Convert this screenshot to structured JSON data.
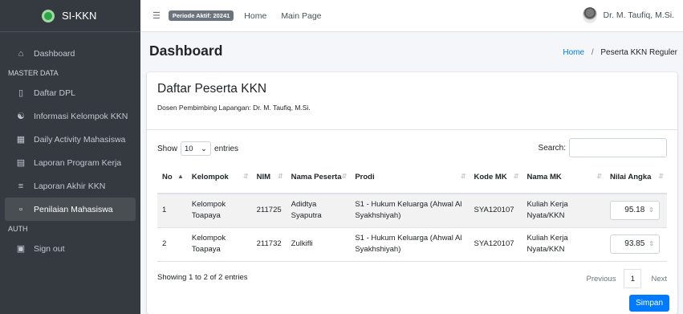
{
  "brand": {
    "name": "SI-KKN"
  },
  "sidebar": {
    "items": [
      {
        "label": "Dashboard",
        "icon": "home-icon"
      },
      {
        "label": "Daftar DPL",
        "icon": "book-icon"
      },
      {
        "label": "Informasi Kelompok KKN",
        "icon": "users-icon"
      },
      {
        "label": "Daily Activity Mahasiswa",
        "icon": "table-icon"
      },
      {
        "label": "Laporan Program Kerja",
        "icon": "file-icon"
      },
      {
        "label": "Laporan Akhir KKN",
        "icon": "list-icon"
      },
      {
        "label": "Penilaian Mahasiswa",
        "icon": "file-check-icon"
      },
      {
        "label": "Sign out",
        "icon": "signout-icon"
      }
    ],
    "headers": [
      "MASTER DATA",
      "AUTH"
    ]
  },
  "topbar": {
    "periode": "Periode Aktif: 20241",
    "links": [
      "Home",
      "Main Page"
    ],
    "user": "Dr. M. Taufiq, M.Si."
  },
  "page": {
    "title": "Dashboard",
    "breadcrumb": {
      "home": "Home",
      "separator": "/",
      "current": "Peserta KKN Reguler"
    }
  },
  "card": {
    "title": "Daftar Peserta KKN",
    "subtitle": "Dosen Pembimbing Lapangan: Dr. M. Taufiq, M.Si."
  },
  "datatable": {
    "show_label": "Show",
    "entries_value": "10",
    "entries_label": "entries",
    "search_label": "Search:",
    "search_value": "",
    "columns": [
      "No",
      "Kelompok",
      "NIM",
      "Nama Peserta",
      "Prodi",
      "Kode MK",
      "Nama MK",
      "Nilai Angka"
    ],
    "rows": [
      {
        "no": "1",
        "kelompok": "Kelompok Toapaya",
        "nim": "211725",
        "nama": "Adidtya Syaputra",
        "prodi": "S1 - Hukum Keluarga (Ahwal Al Syakhshiyah)",
        "kode_mk": "SYA120107",
        "nama_mk": "Kuliah Kerja Nyata/KKN",
        "nilai": "95.18"
      },
      {
        "no": "2",
        "kelompok": "Kelompok Toapaya",
        "nim": "211732",
        "nama": "Zulkifli",
        "prodi": "S1 - Hukum Keluarga (Ahwal Al Syakhshiyah)",
        "kode_mk": "SYA120107",
        "nama_mk": "Kuliah Kerja Nyata/KKN",
        "nilai": "93.85"
      }
    ],
    "info": "Showing 1 to 2 of 2 entries",
    "pager": {
      "previous": "Previous",
      "current": "1",
      "next": "Next"
    },
    "save_label": "Simpan"
  },
  "colors": {
    "sidebar_bg": "#343a40",
    "primary": "#007bff",
    "brand_green": "#28a745"
  }
}
